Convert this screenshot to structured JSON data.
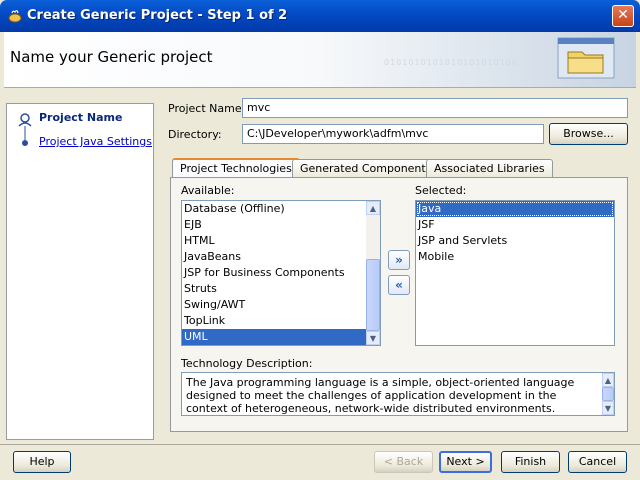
{
  "window": {
    "title": "Create Generic Project - Step 1 of 2",
    "close_glyph": "✕"
  },
  "header": {
    "title": "Name your Generic project",
    "binary": "0101010101010101010100"
  },
  "steps": [
    {
      "label": "Project Name"
    },
    {
      "label": "Project Java Settings"
    }
  ],
  "form": {
    "project_name_label": "Project Name:",
    "project_name_value": "mvc",
    "directory_label": "Directory:",
    "directory_value": "C:\\JDeveloper\\mywork\\adfm\\mvc",
    "browse_label": "Browse..."
  },
  "tabs": [
    {
      "label": "Project Technologies",
      "active": true
    },
    {
      "label": "Generated Components",
      "active": false
    },
    {
      "label": "Associated Libraries",
      "active": false
    }
  ],
  "available": {
    "label": "Available:",
    "items": [
      "Database (Offline)",
      "EJB",
      "HTML",
      "JavaBeans",
      "JSP for Business Components",
      "Struts",
      "Swing/AWT",
      "TopLink",
      "UML"
    ],
    "selected_index": 8
  },
  "selected": {
    "label": "Selected:",
    "items": [
      "Java",
      "JSF",
      "JSP and Servlets",
      "Mobile"
    ],
    "selected_index": 0
  },
  "move_buttons": {
    "add": "»",
    "remove": "«"
  },
  "technology_description": {
    "label": "Technology Description:",
    "text": "The Java programming language is a simple, object-oriented language designed to meet the challenges of application development in the context of heterogeneous, network-wide distributed environments."
  },
  "footer": {
    "help": "Help",
    "back": "< Back",
    "next": "Next >",
    "finish": "Finish",
    "cancel": "Cancel"
  },
  "colors": {
    "selection": "#316ac5",
    "titlebar": "#0348c1",
    "tab_accent": "#e68b2c"
  }
}
